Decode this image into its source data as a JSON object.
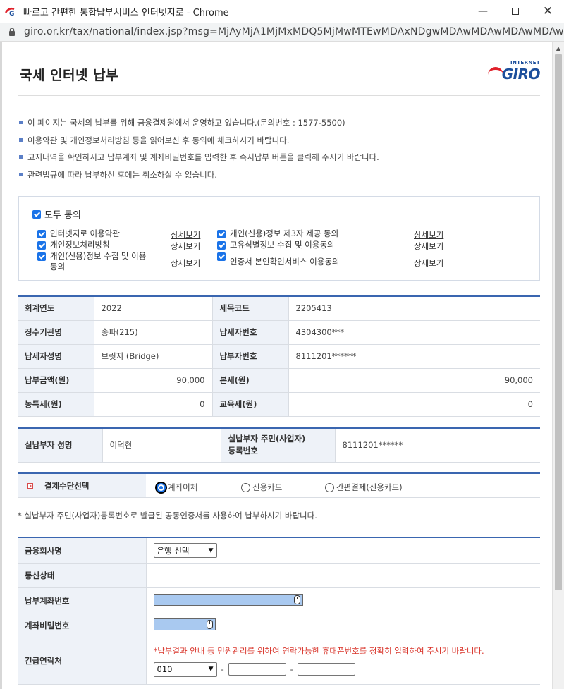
{
  "window": {
    "title": "빠르고 간편한 통합납부서비스 인터넷지로 - Chrome",
    "url": "giro.or.kr/tax/national/index.jsp?msg=MjAyMjA1MjMxMDQ5MjMwMTEwMDAxNDgwMDAwMDAwMDAwMDAwMDA..."
  },
  "header": {
    "title": "국세 인터넷 납부",
    "logo_small": "INTERNET",
    "logo_big": "GIRO"
  },
  "notices": [
    "이 페이지는 국세의 납부를 위해 금융결제원에서 운영하고 있습니다.(문의번호 : 1577-5500)",
    "이용약관 및 개인정보처리방침 등을 읽어보신 후 동의에 체크하시기 바랍니다.",
    "고지내역을 확인하시고 납부계좌 및 계좌비밀번호를 입력한 후 즉시납부 버튼을 클릭해 주시기 바랍니다.",
    "관련법규에 따라 납부하신 후에는 취소하실 수 없습니다."
  ],
  "agreements": {
    "all_label": "모두 동의",
    "detail_label": "상세보기",
    "left": [
      "인터넷지로 이용약관",
      "개인정보처리방침",
      "개인(신용)정보 수집 및 이용\n동의"
    ],
    "right": [
      "개인(신용)정보 제3자 제공 동의",
      "고유식별정보 수집 및 이용동의",
      "인증서 본인확인서비스 이용동의"
    ]
  },
  "info": {
    "rows": [
      {
        "l_label": "회계연도",
        "l_value": "2022",
        "r_label": "세목코드",
        "r_value": "2205413"
      },
      {
        "l_label": "징수기관명",
        "l_value": "송파(215)",
        "r_label": "납세자번호",
        "r_value": "4304300***"
      },
      {
        "l_label": "납세자성명",
        "l_value": "브릿지 (Bridge)",
        "r_label": "납부자번호",
        "r_value": "8111201******"
      },
      {
        "l_label": "납부금액(원)",
        "l_value": "90,000",
        "r_label": "본세(원)",
        "r_value": "90,000"
      },
      {
        "l_label": "농특세(원)",
        "l_value": "0",
        "r_label": "교육세(원)",
        "r_value": "0"
      }
    ]
  },
  "payer": {
    "name_label": "실납부자 성명",
    "name_value": "이덕현",
    "id_label": "실납부자 주민(사업자)\n등록번호",
    "id_value": "8111201******"
  },
  "method": {
    "label": "결제수단선택",
    "options": [
      "계좌이체",
      "신용카드",
      "간편결제(신용카드)"
    ],
    "selected": "계좌이체"
  },
  "note": "* 실납부자 주민(사업자)등록번호로 발급된 공동인증서를 사용하여 납부하시기 바랍니다.",
  "bank": {
    "bank_label": "금융회사명",
    "bank_select": "은행 선택",
    "status_label": "통신상태",
    "account_label": "납부계좌번호",
    "password_label": "계좌비밀번호",
    "contact_label": "긴급연락처",
    "contact_notice": "*납부결과 안내 등 민원관리를 위하여 연락가능한 휴대폰번호를 정확히 입력하여 주시기 바랍니다.",
    "phone_prefix": "010",
    "dash": "-"
  }
}
